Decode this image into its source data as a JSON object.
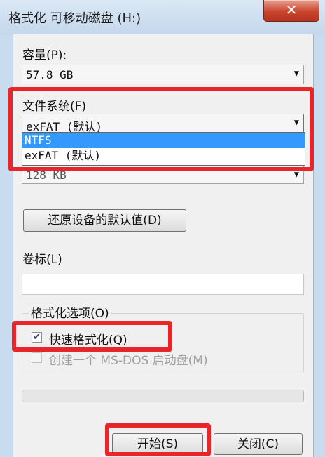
{
  "window": {
    "title": "格式化 可移动磁盘 (H:)",
    "close_glyph": "✕"
  },
  "capacity": {
    "label": "容量(P):",
    "value": "57.8 GB"
  },
  "filesystem": {
    "label": "文件系统(F)",
    "value": "exFAT (默认)",
    "options": [
      "NTFS",
      "exFAT (默认)"
    ],
    "highlighted_option": "NTFS"
  },
  "allocation": {
    "value": "128 KB"
  },
  "restore_defaults_button": "还原设备的默认值(D)",
  "volume_label": {
    "label": "卷标(L)",
    "value": ""
  },
  "format_options": {
    "legend": "格式化选项(O)",
    "quick_format": {
      "label": "快速格式化(Q)",
      "checked": true
    },
    "msdos_boot": {
      "label": "创建一个 MS-DOS 启动盘(M)",
      "checked": false,
      "enabled": false
    }
  },
  "progress": {
    "value": 0
  },
  "buttons": {
    "start": "开始(S)",
    "close": "关闭(C)"
  },
  "icons": {
    "dropdown": "▼",
    "check": "✔"
  },
  "colors": {
    "highlight": "#e8262a",
    "selected_option": "#3399ff"
  }
}
